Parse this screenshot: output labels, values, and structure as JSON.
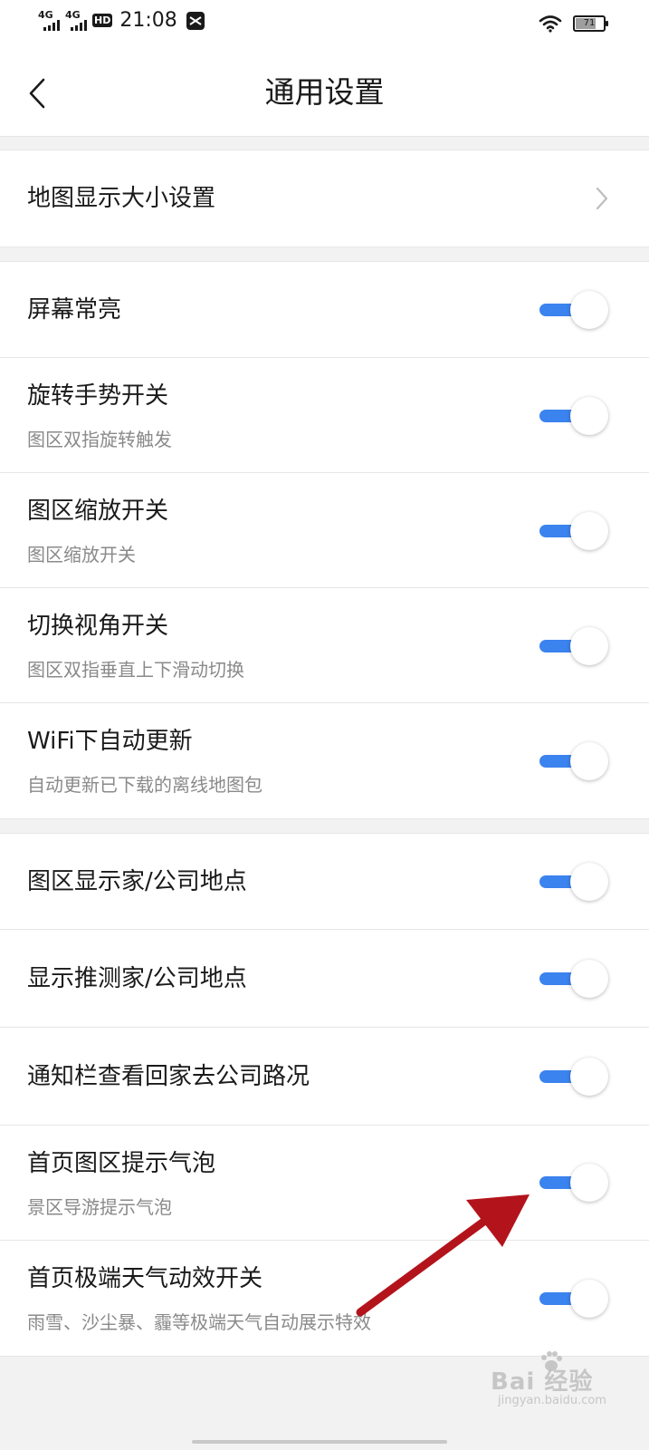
{
  "status_bar": {
    "signal1_label": "4G",
    "signal2_label": "4G",
    "hd_label": "HD",
    "time": "21:08",
    "battery_level": "71"
  },
  "nav": {
    "title": "通用设置"
  },
  "sections": {
    "map_size": {
      "title": "地图显示大小设置"
    },
    "screen_on": {
      "title": "屏幕常亮",
      "enabled": true
    },
    "rotate": {
      "title": "旋转手势开关",
      "subtitle": "图区双指旋转触发",
      "enabled": true
    },
    "zoom": {
      "title": "图区缩放开关",
      "subtitle": "图区缩放开关",
      "enabled": true
    },
    "view_angle": {
      "title": "切换视角开关",
      "subtitle": "图区双指垂直上下滑动切换",
      "enabled": true
    },
    "wifi_update": {
      "title": "WiFi下自动更新",
      "subtitle": "自动更新已下载的离线地图包",
      "enabled": true
    },
    "show_home_company": {
      "title": "图区显示家/公司地点",
      "enabled": true
    },
    "guess_home_company": {
      "title": "显示推测家/公司地点",
      "enabled": true
    },
    "notification_traffic": {
      "title": "通知栏查看回家去公司路况",
      "enabled": true
    },
    "bubble_tips": {
      "title": "首页图区提示气泡",
      "subtitle": "景区导游提示气泡",
      "enabled": true
    },
    "extreme_weather": {
      "title": "首页极端天气动效开关",
      "subtitle": "雨雪、沙尘暴、霾等极端天气自动展示特效",
      "enabled": true
    }
  },
  "colors": {
    "toggle_on": "#3b83ee",
    "annotation_arrow": "#b3141b"
  },
  "watermark": {
    "main": "Bai 经验",
    "sub": "jingyan.baidu.com"
  }
}
